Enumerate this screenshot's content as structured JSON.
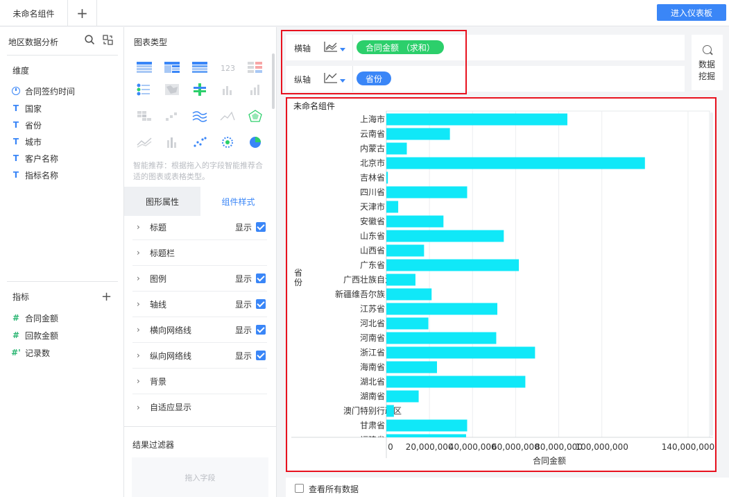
{
  "topbar": {
    "tab_label": "未命名组件",
    "add_tab_label": "+",
    "enter_dashboard_label": "进入仪表板"
  },
  "data_panel": {
    "title": "地区数据分析",
    "dimension_heading": "维度",
    "dimensions": [
      {
        "label": "合同签约时间",
        "type": "date"
      },
      {
        "label": "国家",
        "type": "text"
      },
      {
        "label": "省份",
        "type": "text"
      },
      {
        "label": "城市",
        "type": "text"
      },
      {
        "label": "客户名称",
        "type": "text"
      },
      {
        "label": "指标名称",
        "type": "text"
      }
    ],
    "measure_heading": "指标",
    "measures": [
      {
        "label": "合同金额",
        "type": "number",
        "icon": "#"
      },
      {
        "label": "回款金额",
        "type": "number",
        "icon": "#"
      },
      {
        "label": "记录数",
        "type": "count",
        "icon": "#'"
      }
    ]
  },
  "config_panel": {
    "chart_type_heading": "图表类型",
    "hint": "智能推荐：根据拖入的字段智能推荐合适的图表或表格类型。",
    "tabs": [
      "图形属性",
      "组件样式"
    ],
    "active_tab": "组件样式",
    "props": [
      {
        "label": "标题",
        "show_label": "显示",
        "checked": true
      },
      {
        "label": "标题栏",
        "show_label": "",
        "checked": false
      },
      {
        "label": "图例",
        "show_label": "显示",
        "checked": true
      },
      {
        "label": "轴线",
        "show_label": "显示",
        "checked": true
      },
      {
        "label": "横向网络线",
        "show_label": "显示",
        "checked": true
      },
      {
        "label": "纵向网络线",
        "show_label": "显示",
        "checked": true
      },
      {
        "label": "背景",
        "show_label": "",
        "checked": false
      },
      {
        "label": "自适应显示",
        "show_label": "",
        "checked": false
      }
    ],
    "filter_heading": "结果过滤器",
    "filter_placeholder": "拖入字段"
  },
  "axes": {
    "x_label": "横轴",
    "x_field": "合同金额 （求和）",
    "y_label": "纵轴",
    "y_field": "省份"
  },
  "mining": {
    "label": "数据挖掘"
  },
  "chart": {
    "component_title": "未命名组件"
  },
  "chart_data": {
    "type": "bar",
    "orientation": "horizontal",
    "xlabel": "合同金额",
    "ylabel": "省份",
    "bar_color": "#10e8f8",
    "xlim": [
      0,
      150000000
    ],
    "xticks": [
      "0",
      "20,000,000",
      "40,000,000",
      "60,000,000",
      "80,000,000",
      "100,000,000",
      "140,000,000"
    ],
    "xtick_values": [
      0,
      20000000,
      40000000,
      60000000,
      80000000,
      100000000,
      140000000
    ],
    "grid_vertical": true,
    "categories": [
      "上海市",
      "云南省",
      "内蒙古",
      "北京市",
      "吉林省",
      "四川省",
      "天津市",
      "安徽省",
      "山东省",
      "山西省",
      "广东省",
      "广西壮族自治区",
      "新疆维吾尔族自治区",
      "江苏省",
      "河北省",
      "河南省",
      "浙江省",
      "海南省",
      "湖北省",
      "湖南省",
      "澳门特别行政区",
      "甘肃省",
      "福建省"
    ],
    "values": [
      84000000,
      29500000,
      9500000,
      120000000,
      700000,
      37500000,
      5500000,
      26500000,
      54500000,
      17500000,
      61500000,
      13500000,
      21000000,
      51500000,
      19500000,
      51000000,
      69000000,
      23500000,
      64500000,
      15000000,
      3500000,
      37500000,
      37000000
    ]
  },
  "bottom": {
    "view_all_label": "查看所有数据",
    "view_all_checked": false
  },
  "colors": {
    "accent": "#3a86f7",
    "pill_green": "#2ccf6b",
    "highlight_red": "#e8111e"
  }
}
